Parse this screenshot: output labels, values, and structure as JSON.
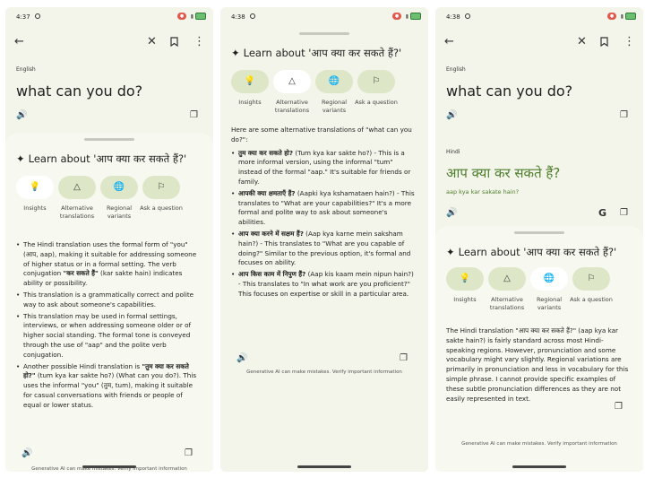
{
  "status": {
    "p1_time": "4:37",
    "p2_time": "4:38",
    "p3_time": "4:38"
  },
  "source": {
    "language": "English",
    "text": "what can you do?"
  },
  "target": {
    "language": "Hindi",
    "text": "आप क्या कर सकते हैं?",
    "transliteration": "aap kya kar sakate hain?"
  },
  "learn": {
    "title": "Learn about 'आप क्या कर सकते हैं?'",
    "chips": [
      {
        "label": "Insights",
        "icon": "lightbulb-icon"
      },
      {
        "label": "Alternative translations",
        "icon": "shapes-icon"
      },
      {
        "label": "Regional variants",
        "icon": "globe-icon"
      },
      {
        "label": "Ask a question",
        "icon": "chat-flag-icon"
      }
    ],
    "disclaimer": "Generative AI can make mistakes. Verify important information"
  },
  "p1": {
    "bullets": [
      {
        "pre": "The Hindi translation uses the formal form of \"you\" (आप, aap), making it suitable for addressing someone of higher status or in a formal setting. The verb conjugation ",
        "bold": "\"कर सकते हैं\"",
        "post": " (kar sakte hain) indicates ability or possibility."
      },
      {
        "pre": "This translation is a grammatically correct and polite way to ask about someone's capabilities.",
        "bold": "",
        "post": ""
      },
      {
        "pre": "This translation may be used in formal settings, interviews, or when addressing someone older or of higher social standing.  The formal tone is conveyed through the use of \"aap\" and the polite verb conjugation.",
        "bold": "",
        "post": ""
      },
      {
        "pre": "Another possible Hindi translation is ",
        "bold": "\"तुम क्या कर सकते हो?\"",
        "post": " (tum kya kar sakte ho?) (What can you do?). This uses the informal \"you\" (तुम, tum), making it suitable for casual conversations with friends or people of equal or lower status."
      }
    ]
  },
  "p2": {
    "intro": "Here are some alternative translations of \"what can you do?\":",
    "bullets": [
      {
        "bold": "तुम क्या कर सकते हो?",
        "post": " (Tum kya kar sakte ho?) - This is a more informal version, using the informal \"tum\" instead of the formal \"aap.\"  It's suitable for friends or family."
      },
      {
        "bold": "आपकी क्या क्षमताएँ हैं?",
        "post": " (Aapki kya kshamataen hain?) - This translates to \"What are your capabilities?\" It's a more formal and polite way to ask about someone's abilities."
      },
      {
        "bold": "आप क्या करने में सक्षम हैं?",
        "post": " (Aap kya karne mein saksham hain?) - This translates to \"What are you capable of doing?\"  Similar to the previous option, it's formal and focuses on ability."
      },
      {
        "bold": "आप किस काम में निपुण हैं?",
        "post": " (Aap kis kaam mein nipun hain?) - This translates to \"In what work are you proficient?\"  This focuses on expertise or skill in a particular area."
      }
    ]
  },
  "p3": {
    "body": "The Hindi translation \"आप क्या कर सकते हैं?\" (aap kya kar sakte hain?) is fairly standard across most Hindi-speaking regions.  However, pronunciation and some vocabulary might vary slightly.  Regional variations are primarily in pronunciation and less in vocabulary for this simple phrase.  I cannot provide specific examples of these subtle pronunciation differences as they are not easily represented in text."
  },
  "colors": {
    "background": "#f3f5ea",
    "chip": "#dde7c7",
    "chip_selected": "#ffffff",
    "hindi_green": "#4e7d2c"
  }
}
